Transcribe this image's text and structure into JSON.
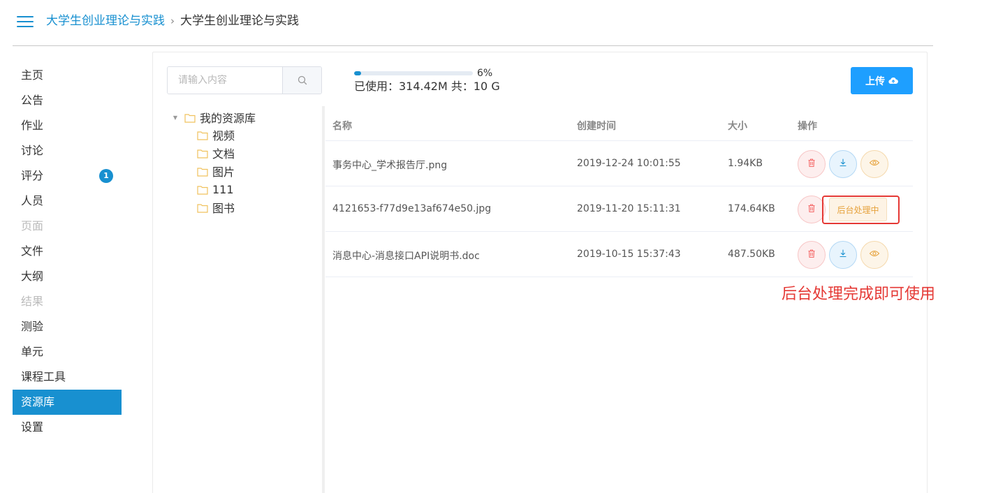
{
  "header": {
    "breadcrumb_link": "大学生创业理论与实践",
    "breadcrumb_sep": "›",
    "breadcrumb_current": "大学生创业理论与实践"
  },
  "sidebar": {
    "items": [
      {
        "label": "主页",
        "state": "normal"
      },
      {
        "label": "公告",
        "state": "normal"
      },
      {
        "label": "作业",
        "state": "normal"
      },
      {
        "label": "讨论",
        "state": "normal"
      },
      {
        "label": "评分",
        "state": "normal",
        "badge": "1"
      },
      {
        "label": "人员",
        "state": "normal"
      },
      {
        "label": "页面",
        "state": "disabled"
      },
      {
        "label": "文件",
        "state": "normal"
      },
      {
        "label": "大纲",
        "state": "normal"
      },
      {
        "label": "结果",
        "state": "disabled"
      },
      {
        "label": "测验",
        "state": "normal"
      },
      {
        "label": "单元",
        "state": "normal"
      },
      {
        "label": "课程工具",
        "state": "normal"
      },
      {
        "label": "资源库",
        "state": "active"
      },
      {
        "label": "设置",
        "state": "normal"
      }
    ]
  },
  "search": {
    "placeholder": "请输入内容",
    "value": ""
  },
  "storage": {
    "percent_label": "6%",
    "fraction": 0.06,
    "usage_text": "已使用：314.42M 共：10 G"
  },
  "upload": {
    "label": "上传"
  },
  "tree": {
    "root": "我的资源库",
    "children": [
      "视频",
      "文档",
      "图片",
      "111",
      "图书"
    ]
  },
  "table": {
    "headers": {
      "name": "名称",
      "time": "创建时间",
      "size": "大小",
      "ops": "操作"
    },
    "rows": [
      {
        "name": "事务中心_学术报告厅.png",
        "time": "2019-12-24 10:01:55",
        "size": "1.94KB",
        "processing": false
      },
      {
        "name": "4121653-f77d9e13af674e50.jpg",
        "time": "2019-11-20 15:11:31",
        "size": "174.64KB",
        "processing": true,
        "processing_label": "后台处理中"
      },
      {
        "name": "消息中心-消息接口API说明书.doc",
        "time": "2019-10-15 15:37:43",
        "size": "487.50KB",
        "processing": false
      }
    ]
  },
  "annotation": {
    "text": "后台处理完成即可使用"
  },
  "colors": {
    "primary": "#1890d0",
    "upload": "#1e9fff",
    "danger": "#f56c6c",
    "warning": "#e6a23c",
    "annotation": "#e53935"
  },
  "icons": {
    "menu": "hamburger-icon",
    "search": "search-icon",
    "upload": "cloud-upload-icon",
    "folder": "folder-icon",
    "delete": "trash-icon",
    "download": "download-icon",
    "view": "eye-icon"
  }
}
